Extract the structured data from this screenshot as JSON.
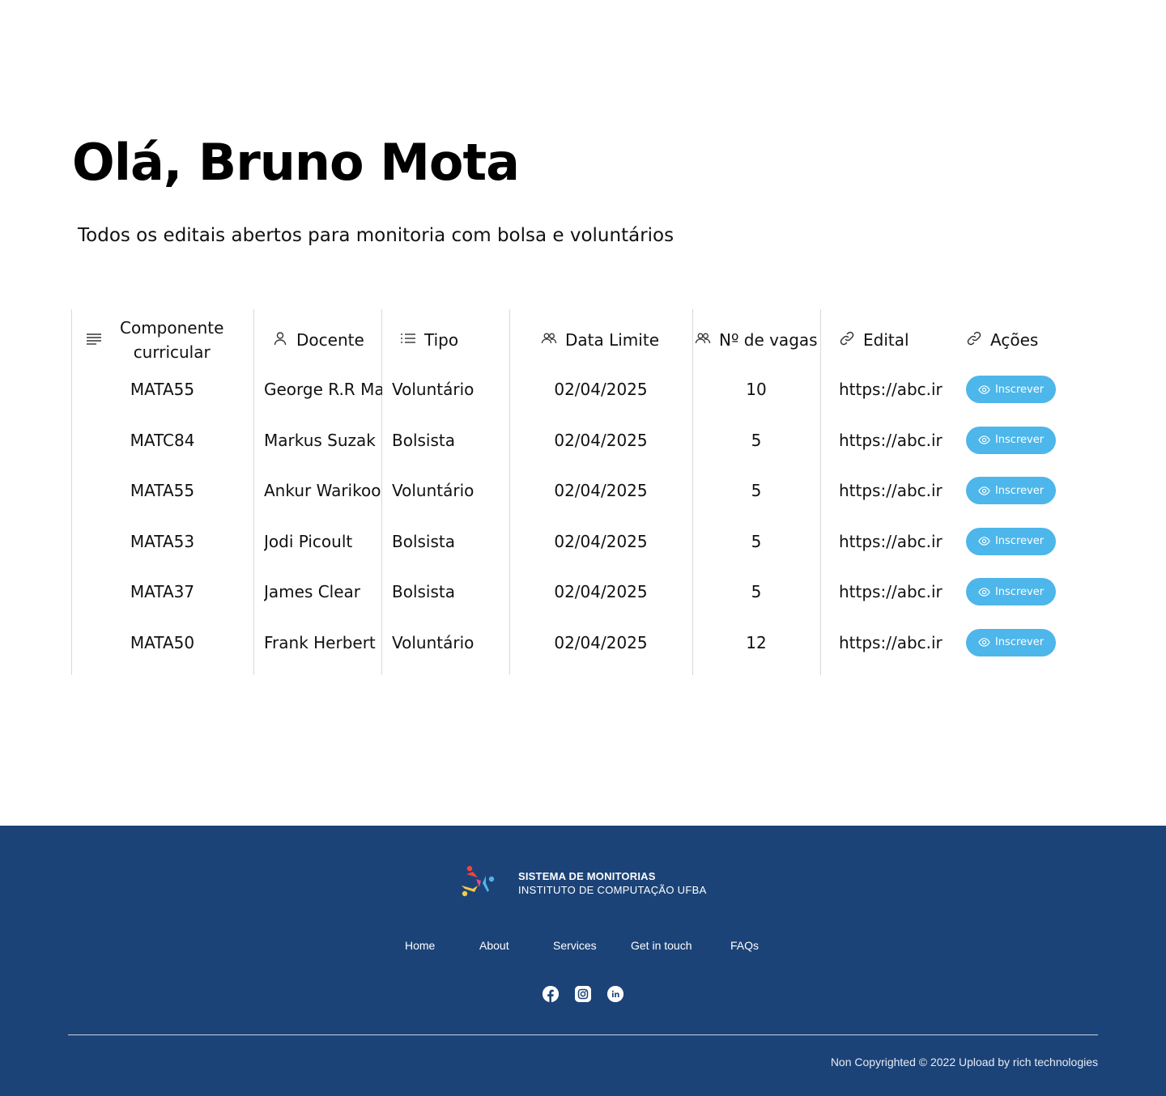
{
  "header": {
    "greeting": "Olá, Bruno Mota",
    "subtitle": "Todos os editais abertos para monitoria com bolsa e voluntários"
  },
  "table": {
    "columns": {
      "componente_line1": "Componente",
      "componente_line2": "curricular",
      "docente": "Docente",
      "tipo": "Tipo",
      "data_limite": "Data Limite",
      "vagas": "Nº de vagas",
      "edital": "Edital",
      "acoes": "Ações"
    },
    "rows": [
      {
        "componente": "MATA55",
        "docente": "George R.R  Martin",
        "tipo": "Voluntário",
        "data": "02/04/2025",
        "vagas": "10",
        "edital": "https://abc.ir",
        "acao": "Inscrever"
      },
      {
        "componente": "MATC84",
        "docente": "Markus Suzak",
        "tipo": "Bolsista",
        "data": "02/04/2025",
        "vagas": "5",
        "edital": "https://abc.ir",
        "acao": "Inscrever"
      },
      {
        "componente": "MATA55",
        "docente": "Ankur Warikoo",
        "tipo": "Voluntário",
        "data": "02/04/2025",
        "vagas": "5",
        "edital": "https://abc.ir",
        "acao": "Inscrever"
      },
      {
        "componente": "MATA53",
        "docente": "Jodi Picoult",
        "tipo": "Bolsista",
        "data": "02/04/2025",
        "vagas": "5",
        "edital": "https://abc.ir",
        "acao": "Inscrever"
      },
      {
        "componente": "MATA37",
        "docente": "James Clear",
        "tipo": "Bolsista",
        "data": "02/04/2025",
        "vagas": "5",
        "edital": "https://abc.ir",
        "acao": "Inscrever"
      },
      {
        "componente": "MATA50",
        "docente": "Frank Herbert",
        "tipo": "Voluntário",
        "data": "02/04/2025",
        "vagas": "12",
        "edital": "https://abc.ir",
        "acao": "Inscrever"
      }
    ]
  },
  "footer": {
    "brand_title": "SISTEMA DE MONITORIAS",
    "brand_subtitle": "INSTITUTO DE COMPUTAÇÃO UFBA",
    "nav": [
      "Home",
      "About",
      "Services",
      "Get in touch",
      "FAQs"
    ],
    "social": [
      "facebook-icon",
      "instagram-icon",
      "linkedin-icon"
    ],
    "copyright": "Non Copyrighted © 2022 Upload by rich technologies"
  },
  "colors": {
    "footer_bg": "#1c4377",
    "button_bg": "#4db6ea"
  }
}
